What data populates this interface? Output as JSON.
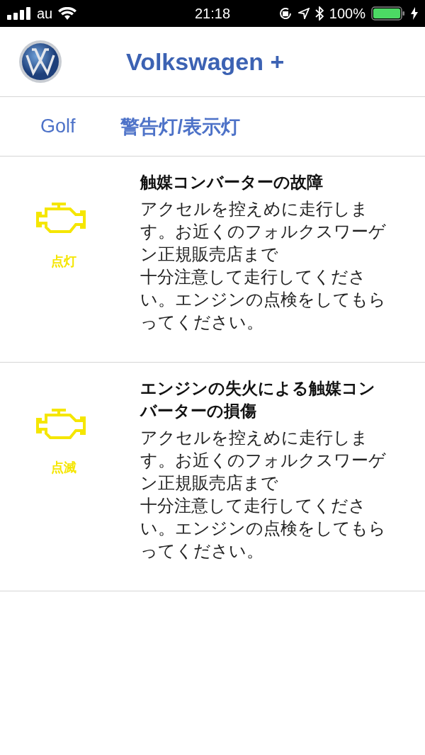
{
  "status_bar": {
    "carrier": "au",
    "time": "21:18",
    "battery": "100%"
  },
  "header": {
    "title": "Volkswagen +"
  },
  "nav": {
    "model": "Golf",
    "section": "警告灯/表示灯"
  },
  "warnings": [
    {
      "state": "点灯",
      "title": "触媒コンバーターの故障",
      "description": [
        "アクセルを控えめに走行します。お近くのフォルクスワーゲン正規販売店まで",
        "十分注意して走行してください。エンジンの点検をしてもらってください。"
      ]
    },
    {
      "state": "点滅",
      "title": "エンジンの失火による触媒コンバーターの損傷",
      "description": [
        "アクセルを控えめに走行します。お近くのフォルクスワーゲン正規販売店まで",
        "十分注意して走行してください。エンジンの点検をしてもらってください。"
      ]
    }
  ]
}
